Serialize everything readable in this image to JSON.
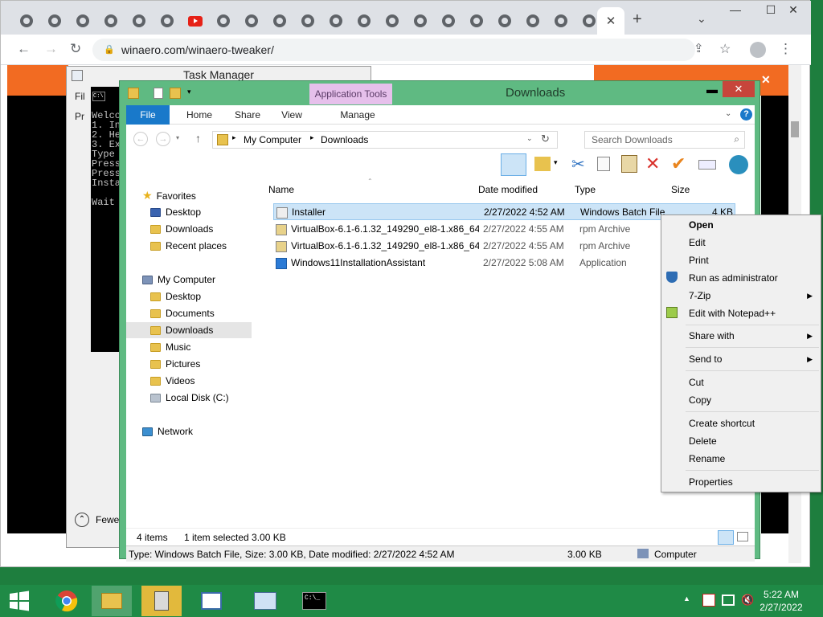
{
  "browser": {
    "url": "winaero.com/winaero-tweaker/",
    "new_tab": "+",
    "tab_close": "✕",
    "minimize": "—",
    "maximize": "☐",
    "close": "✕"
  },
  "taskmgr": {
    "title": "Task Manager",
    "menu_partial": "Fil",
    "tab_partial": "Pr",
    "fewer_details": "Fewe"
  },
  "cmd": {
    "lines": "Welco\n1. In\n2. He\n3. Ex\nType\nPress\nPress\nInsta\n\nWait"
  },
  "explorer": {
    "title": "Downloads",
    "app_tools": "Application Tools",
    "tabs": [
      "File",
      "Home",
      "Share",
      "View",
      "Manage"
    ],
    "breadcrumb": [
      "My Computer",
      "Downloads"
    ],
    "search_placeholder": "Search Downloads",
    "nav": {
      "favorites": "Favorites",
      "fav_items": [
        "Desktop",
        "Downloads",
        "Recent places"
      ],
      "computer": "My Computer",
      "comp_items": [
        "Desktop",
        "Documents",
        "Downloads",
        "Music",
        "Pictures",
        "Videos",
        "Local Disk (C:)"
      ],
      "network": "Network"
    },
    "columns": [
      "Name",
      "Date modified",
      "Type",
      "Size"
    ],
    "files": [
      {
        "name": "Installer",
        "date": "2/27/2022 4:52 AM",
        "type": "Windows Batch File",
        "size": "4 KB"
      },
      {
        "name": "VirtualBox-6.1-6.1.32_149290_el8-1.x86_64...",
        "date": "2/27/2022 4:55 AM",
        "type": "rpm Archive",
        "size": ""
      },
      {
        "name": "VirtualBox-6.1-6.1.32_149290_el8-1.x86_64",
        "date": "2/27/2022 4:55 AM",
        "type": "rpm Archive",
        "size": ""
      },
      {
        "name": "Windows11InstallationAssistant",
        "date": "2/27/2022 5:08 AM",
        "type": "Application",
        "size": ""
      }
    ],
    "status_items": "4 items",
    "status_sel": "1 item selected  3.00 KB",
    "info": "Type: Windows Batch File, Size: 3.00 KB, Date modified: 2/27/2022 4:52 AM",
    "info_size": "3.00 KB",
    "info_loc": "Computer"
  },
  "context_menu": [
    "Open",
    "Edit",
    "Print",
    "Run as administrator",
    "7-Zip",
    "Edit with Notepad++",
    "Share with",
    "Send to",
    "Cut",
    "Copy",
    "Create shortcut",
    "Delete",
    "Rename",
    "Properties"
  ],
  "clock": {
    "time": "5:22 AM",
    "date": "2/27/2022"
  }
}
